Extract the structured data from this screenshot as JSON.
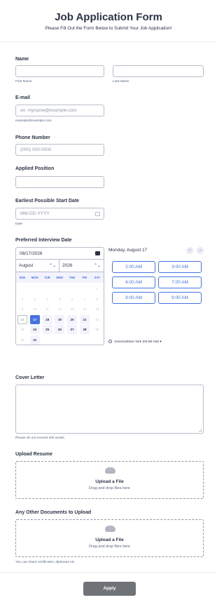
{
  "header": {
    "title": "Job Application Form",
    "subtitle": "Please Fill Out the Form Below to Submit Your Job Application!"
  },
  "name": {
    "label": "Name",
    "first_sublabel": "First Name",
    "last_sublabel": "Last Name",
    "first_value": "",
    "last_value": ""
  },
  "email": {
    "label": "E-mail",
    "placeholder": "ex: myname@example.com",
    "sublabel": "example@example.com"
  },
  "phone": {
    "label": "Phone Number",
    "placeholder": "(000) 000-0000"
  },
  "position": {
    "label": "Applied Position",
    "value": ""
  },
  "start_date": {
    "label": "Earliest Possible Start Date",
    "placeholder": "MM-DD-YYYY",
    "sublabel": "Date"
  },
  "interview": {
    "label": "Preferred Interview Date",
    "date_value": "08/17/2026",
    "month": "August",
    "year": "2026",
    "weekdays": [
      "SUN",
      "MON",
      "TUE",
      "WED",
      "THU",
      "FRI",
      "SAT"
    ],
    "days": [
      {
        "n": "",
        "s": "blank"
      },
      {
        "n": "",
        "s": "blank"
      },
      {
        "n": "",
        "s": "blank"
      },
      {
        "n": "",
        "s": "blank"
      },
      {
        "n": "",
        "s": "blank"
      },
      {
        "n": "",
        "s": "blank"
      },
      {
        "n": "1",
        "s": "dis"
      },
      {
        "n": "2",
        "s": "dis"
      },
      {
        "n": "3",
        "s": "dis"
      },
      {
        "n": "4",
        "s": "dis"
      },
      {
        "n": "5",
        "s": "dis"
      },
      {
        "n": "6",
        "s": "dis"
      },
      {
        "n": "7",
        "s": "dis"
      },
      {
        "n": "8",
        "s": "dis"
      },
      {
        "n": "9",
        "s": "dis"
      },
      {
        "n": "10",
        "s": "dis"
      },
      {
        "n": "11",
        "s": "dis"
      },
      {
        "n": "12",
        "s": "dis"
      },
      {
        "n": "13",
        "s": "dis"
      },
      {
        "n": "14",
        "s": "dis"
      },
      {
        "n": "15",
        "s": "dis"
      },
      {
        "n": "16",
        "s": "today"
      },
      {
        "n": "17",
        "s": "sel"
      },
      {
        "n": "18",
        "s": "en"
      },
      {
        "n": "19",
        "s": "en"
      },
      {
        "n": "20",
        "s": "en"
      },
      {
        "n": "21",
        "s": "en"
      },
      {
        "n": "22",
        "s": "dis"
      },
      {
        "n": "23",
        "s": "dis"
      },
      {
        "n": "24",
        "s": "en"
      },
      {
        "n": "25",
        "s": "en"
      },
      {
        "n": "26",
        "s": "en"
      },
      {
        "n": "27",
        "s": "en"
      },
      {
        "n": "28",
        "s": "en"
      },
      {
        "n": "29",
        "s": "dis"
      },
      {
        "n": "30",
        "s": "dis"
      },
      {
        "n": "31",
        "s": "en"
      }
    ],
    "selected_day_label": "Monday, August 17",
    "prev_icon": "chevron-left-icon",
    "next_icon": "chevron-right-icon",
    "slots": [
      "2:00 AM",
      "3:00 AM",
      "4:00 AM",
      "7:00 AM",
      "8:00 AM",
      "9:00 AM"
    ],
    "timezone": "America/New York (04:55 AM)",
    "timezone_caret": "▾"
  },
  "cover_letter": {
    "label": "Cover Letter",
    "value": "",
    "sublabel": "Please do not exceed 200 words."
  },
  "resume": {
    "label": "Upload Resume",
    "title": "Upload a File",
    "subtitle": "Drag and drop files here"
  },
  "other_docs": {
    "label": "Any Other Documents to Upload",
    "title": "Upload a File",
    "subtitle": "Drag and drop files here",
    "sublabel": "You can share certificates, diplomas etc."
  },
  "submit": {
    "label": "Apply"
  },
  "colors": {
    "accent": "#4573e3",
    "button": "#6f7378",
    "text": "#2c3345",
    "border": "#b8bdc9"
  }
}
